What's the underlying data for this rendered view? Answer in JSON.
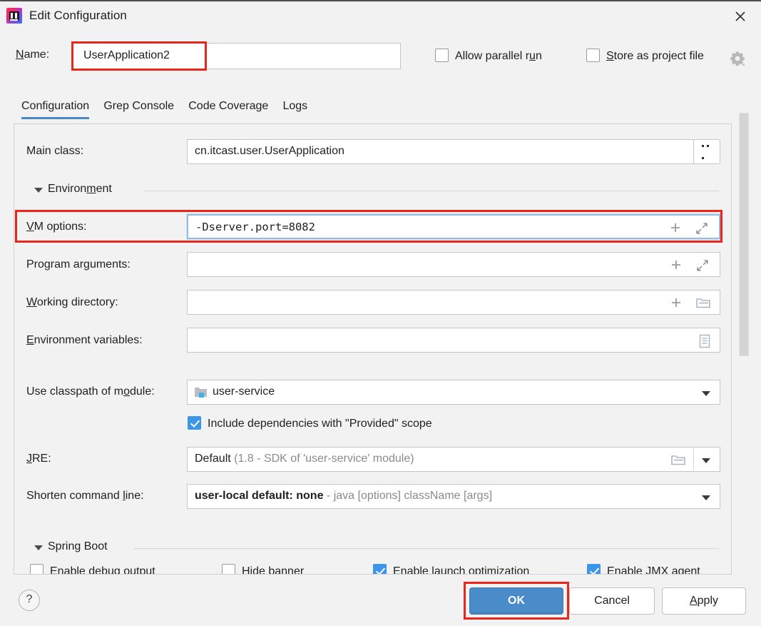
{
  "window": {
    "title": "Edit Configuration",
    "icon": "intellij-idea-icon",
    "close_label": "✕"
  },
  "name_row": {
    "label": "Name:",
    "label_mnemonic": "N",
    "value": "UserApplication2",
    "allow_parallel_run": {
      "label": "Allow parallel run",
      "checked": false,
      "mnemonic": "u"
    },
    "store_as_project_file": {
      "label": "Store as project file",
      "checked": false,
      "mnemonic": "S"
    },
    "gear_icon": "gear-dropdown-icon"
  },
  "tabs": [
    {
      "label": "Configuration",
      "active": true
    },
    {
      "label": "Grep Console",
      "active": false
    },
    {
      "label": "Code Coverage",
      "active": false
    },
    {
      "label": "Logs",
      "active": false
    }
  ],
  "fields": {
    "main_class": {
      "label": "Main class:",
      "value": "cn.itcast.user.UserApplication",
      "browse_button": "..."
    },
    "environment_section": {
      "label": "Environment",
      "expanded": true
    },
    "vm_options": {
      "label": "VM options:",
      "mnemonic": "V",
      "value": "-Dserver.port=8082",
      "focused": true,
      "highlighted": true
    },
    "program_arguments": {
      "label": "Program arguments:",
      "mnemonic": "g",
      "value": ""
    },
    "working_directory": {
      "label": "Working directory:",
      "mnemonic": "W",
      "value": ""
    },
    "environment_variables": {
      "label": "Environment variables:",
      "mnemonic": "E",
      "value": ""
    },
    "use_classpath_of_module": {
      "label": "Use classpath of module:",
      "mnemonic": "o",
      "value": "user-service",
      "icon": "module-folder-icon"
    },
    "include_provided_scope": {
      "label": "Include dependencies with \"Provided\" scope",
      "checked": true
    },
    "jre": {
      "label": "JRE:",
      "mnemonic": "J",
      "value_strong": "Default",
      "value_dim": "(1.8 - SDK of 'user-service' module)"
    },
    "shorten_command_line": {
      "label": "Shorten command line:",
      "mnemonic": "l",
      "value_strong": "user-local default: none",
      "value_dim": "- java [options] className [args]"
    }
  },
  "spring_boot": {
    "section_label": "Spring Boot",
    "expanded": true,
    "checkboxes": [
      {
        "label": "Enable debug output",
        "checked": false
      },
      {
        "label": "Hide banner",
        "checked": false
      },
      {
        "label": "Enable launch optimization",
        "checked": true
      },
      {
        "label": "Enable JMX agent",
        "checked": true
      }
    ]
  },
  "buttons": {
    "help": "?",
    "ok": "OK",
    "cancel": "Cancel",
    "apply": "Apply",
    "apply_mnemonic": "A",
    "ok_highlighted": true
  },
  "colors": {
    "accent_blue": "#4a8bc9",
    "tab_underline": "#4a88c7",
    "highlight_red": "#e8261c",
    "checkbox_checked": "#3d95e8",
    "dialog_bg": "#f2f2f2"
  }
}
